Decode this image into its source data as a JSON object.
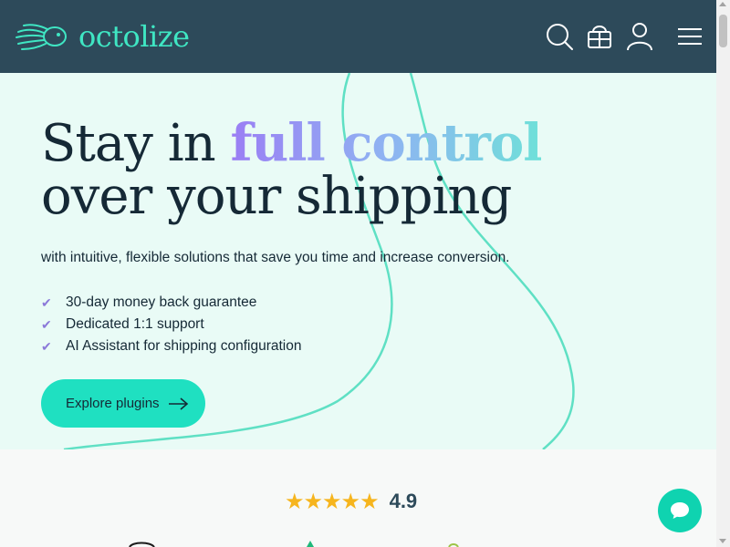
{
  "brand": {
    "name": "octolize",
    "accent": "#3fe6c3",
    "header_bg": "#2d4a5a"
  },
  "header": {
    "icons": [
      "search-icon",
      "cart-icon",
      "user-icon",
      "menu-icon"
    ]
  },
  "hero": {
    "headline_prefix": "Stay in ",
    "headline_highlight": "full control",
    "headline_line2": "over your shipping",
    "subline": "with intuitive, flexible solutions that save you time and increase conversion.",
    "benefits": [
      "30-day money back guarantee",
      "Dedicated 1:1 support",
      "AI Assistant for shipping configuration"
    ],
    "cta_label": "Explore plugins",
    "bg": "#e9fbf6",
    "cta_color": "#1fe0c1"
  },
  "rating": {
    "stars": "★★★★★",
    "score": "4.9",
    "star_color": "#f6b51e"
  },
  "chat": {
    "icon": "chat-icon",
    "color": "#0fd3b0"
  }
}
